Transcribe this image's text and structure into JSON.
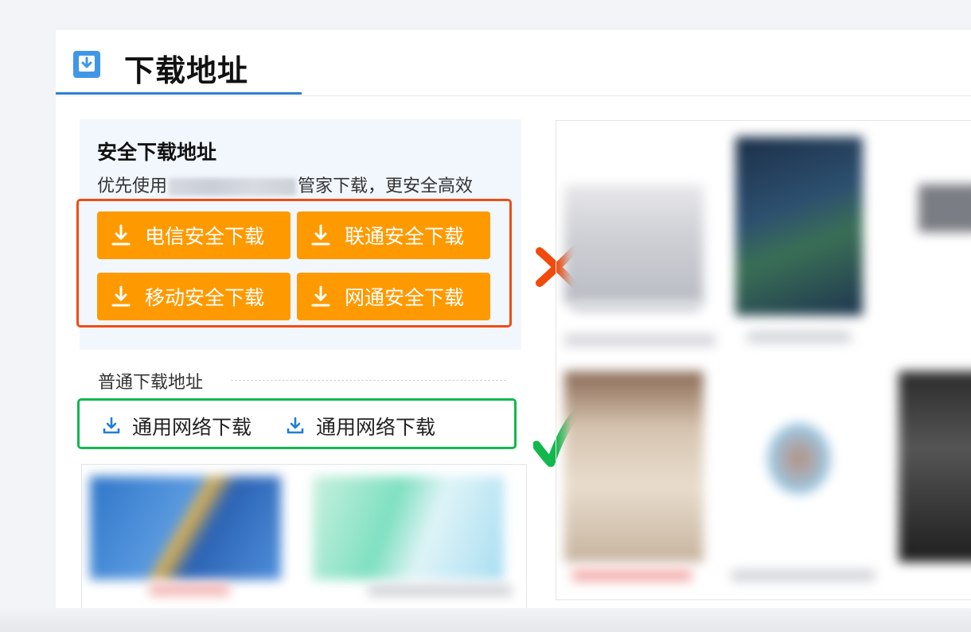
{
  "header": {
    "title": "下载地址",
    "icon": "download-box-icon"
  },
  "safe_download": {
    "title": "安全下载地址",
    "desc_prefix": "优先使用",
    "desc_suffix": "管家下载，更安全高效",
    "buttons": [
      {
        "label": "电信安全下载",
        "icon": "download-arrow-icon"
      },
      {
        "label": "联通安全下载",
        "icon": "download-arrow-icon"
      },
      {
        "label": "移动安全下载",
        "icon": "download-arrow-icon"
      },
      {
        "label": "网通安全下载",
        "icon": "download-arrow-icon"
      }
    ],
    "highlight_color": "#ee4d16",
    "button_color": "#fe9a00"
  },
  "normal_download": {
    "title": "普通下载地址",
    "links": [
      {
        "label": "通用网络下载",
        "icon": "download-tray-icon"
      },
      {
        "label": "通用网络下载",
        "icon": "download-tray-icon"
      }
    ],
    "highlight_color": "#12b84d"
  },
  "annotations": {
    "bad_mark": "cross-mark-icon",
    "good_mark": "check-mark-icon",
    "bad_color": "#f04a0c",
    "good_color": "#12b84d"
  },
  "colors": {
    "accent_blue": "#2d7fd8",
    "link_icon_blue": "#1f7fd4"
  }
}
